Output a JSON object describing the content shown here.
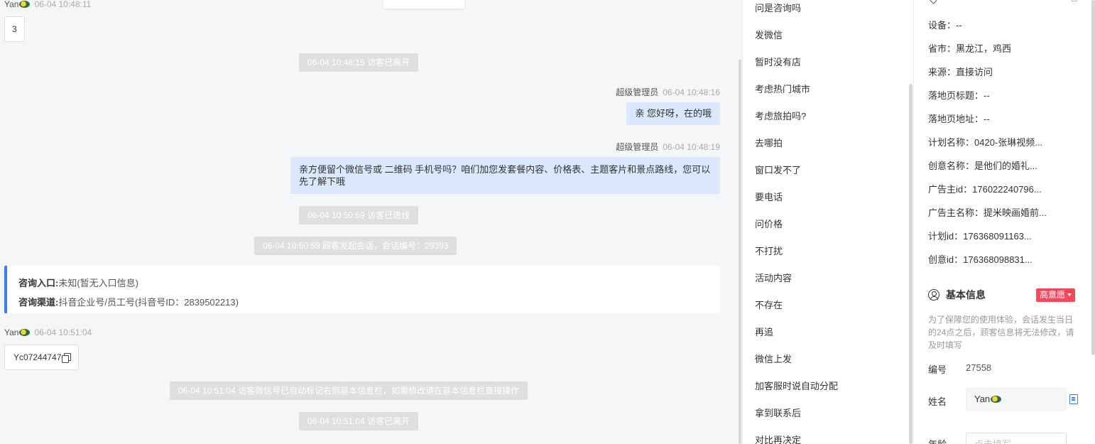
{
  "chat": {
    "msg1": {
      "name": "Yan",
      "time": "06-04 10:48:11",
      "text": "3"
    },
    "sys1": "06-04 10:48:15 访客已离开",
    "msg2": {
      "name": "超级管理员",
      "time": "06-04 10:48:16",
      "text": "亲 您好呀，在的哦"
    },
    "msg3": {
      "name": "超级管理员",
      "time": "06-04 10:48:19",
      "text": "亲方便留个微信号或 二维码 手机号吗？咱们加您发套餐内容、价格表、主题客片和景点路线，您可以先了解下哦"
    },
    "sys2": "06-04 10:50:59 访客已进线",
    "sys3": "06-04 10:50:59 顾客发起会话，会话编号：29393",
    "info_card": {
      "entry_label": "咨询入口:",
      "entry_value": "未知(暂无入口信息)",
      "channel_label": "咨询渠道:",
      "channel_value": "抖音企业号/员工号(抖音号ID：2839502213)"
    },
    "msg4": {
      "name": "Yan",
      "time": "06-04 10:51:04",
      "text": "Yc07244747"
    },
    "sys4": "06-04 10:51:04 访客微信号已自动标记右侧基本信息栏，如需修改请在基本信息栏直接操作",
    "sys5": "06-04 10:51:04 访客已离开"
  },
  "quick_replies": [
    "问是咨询吗",
    "发微信",
    "暂时没有店",
    "考虑热门城市",
    "考虑旅拍吗?",
    "去哪拍",
    "窗口发不了",
    "要电话",
    "问价格",
    "不打扰",
    "活动内容",
    "不存在",
    "再追",
    "微信上发",
    "加客服时说自动分配",
    "拿到联系后",
    "对比再决定"
  ],
  "source_info": [
    {
      "label": "设备：",
      "value": "--"
    },
    {
      "label": "省市：",
      "value": "黑龙江，鸡西"
    },
    {
      "label": "来源：",
      "value": "直接访问"
    },
    {
      "label": "落地页标题：",
      "value": "--"
    },
    {
      "label": "落地页地址：",
      "value": "--"
    },
    {
      "label": "计划名称：",
      "value": "0420-张琳视频..."
    },
    {
      "label": "创意名称：",
      "value": "是他们的婚礼..."
    },
    {
      "label": "广告主id：",
      "value": "176022240796..."
    },
    {
      "label": "广告主名称：",
      "value": "提米映画婚前..."
    },
    {
      "label": "计划id：",
      "value": "176368091163..."
    },
    {
      "label": "创意id：",
      "value": "176368098831..."
    }
  ],
  "basic_info": {
    "title": "基本信息",
    "intent_label": "高意愿",
    "notice": "为了保障您的使用体验，会话发生当日的24点之后，顾客信息将无法修改，请及时填写",
    "id_label": "编号",
    "id_value": "27558",
    "name_label": "姓名",
    "name_value": "Yan",
    "age_label": "年龄",
    "age_placeholder": "点击填写"
  },
  "icons": {
    "emoji": "turtle-emoji",
    "copy": "copy-icon",
    "user": "user-circle-icon",
    "doc": "document-icon",
    "location": "location-pin-icon"
  },
  "colors": {
    "accent": "#3b7ef5",
    "intent_badge": "#f5475d",
    "agent_bubble": "#dbe7fd",
    "system_notice": "#dedfe1"
  }
}
